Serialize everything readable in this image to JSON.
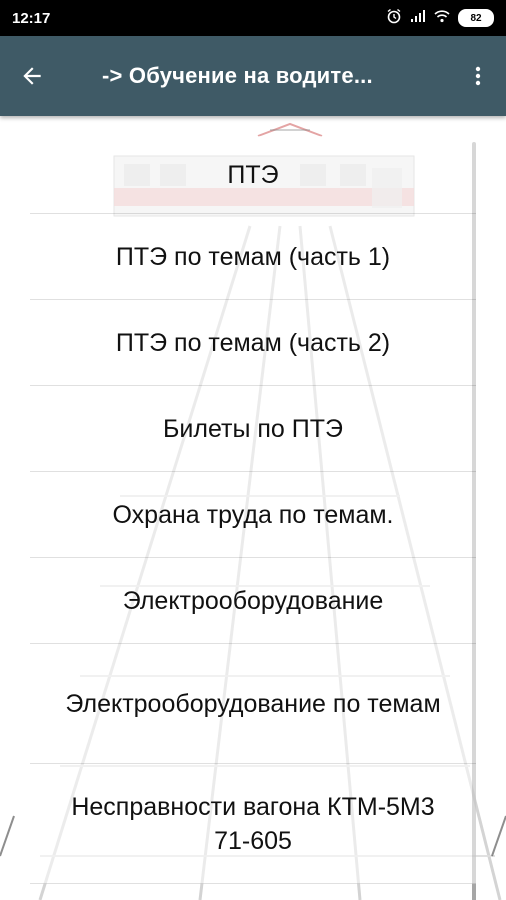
{
  "status_bar": {
    "time": "12:17",
    "battery": "82",
    "icons": [
      "alarm-icon",
      "signal-icon",
      "wifi-icon",
      "battery-icon"
    ]
  },
  "app_bar": {
    "title": "-> Обучение на водите...",
    "color": "#3f5a66",
    "icons": [
      "back-arrow-icon",
      "more-vert-icon"
    ]
  },
  "menu": {
    "items": [
      {
        "label": "ПТЭ"
      },
      {
        "label": "ПТЭ по темам (часть 1)"
      },
      {
        "label": "ПТЭ по темам (часть 2)"
      },
      {
        "label": "Билеты по ПТЭ"
      },
      {
        "label": "Охрана труда по темам."
      },
      {
        "label": "Электрооборудование"
      },
      {
        "label": "Электрооборудование по темам"
      },
      {
        "label": "Несправности вагона КТМ-5М3 71-605"
      }
    ]
  }
}
